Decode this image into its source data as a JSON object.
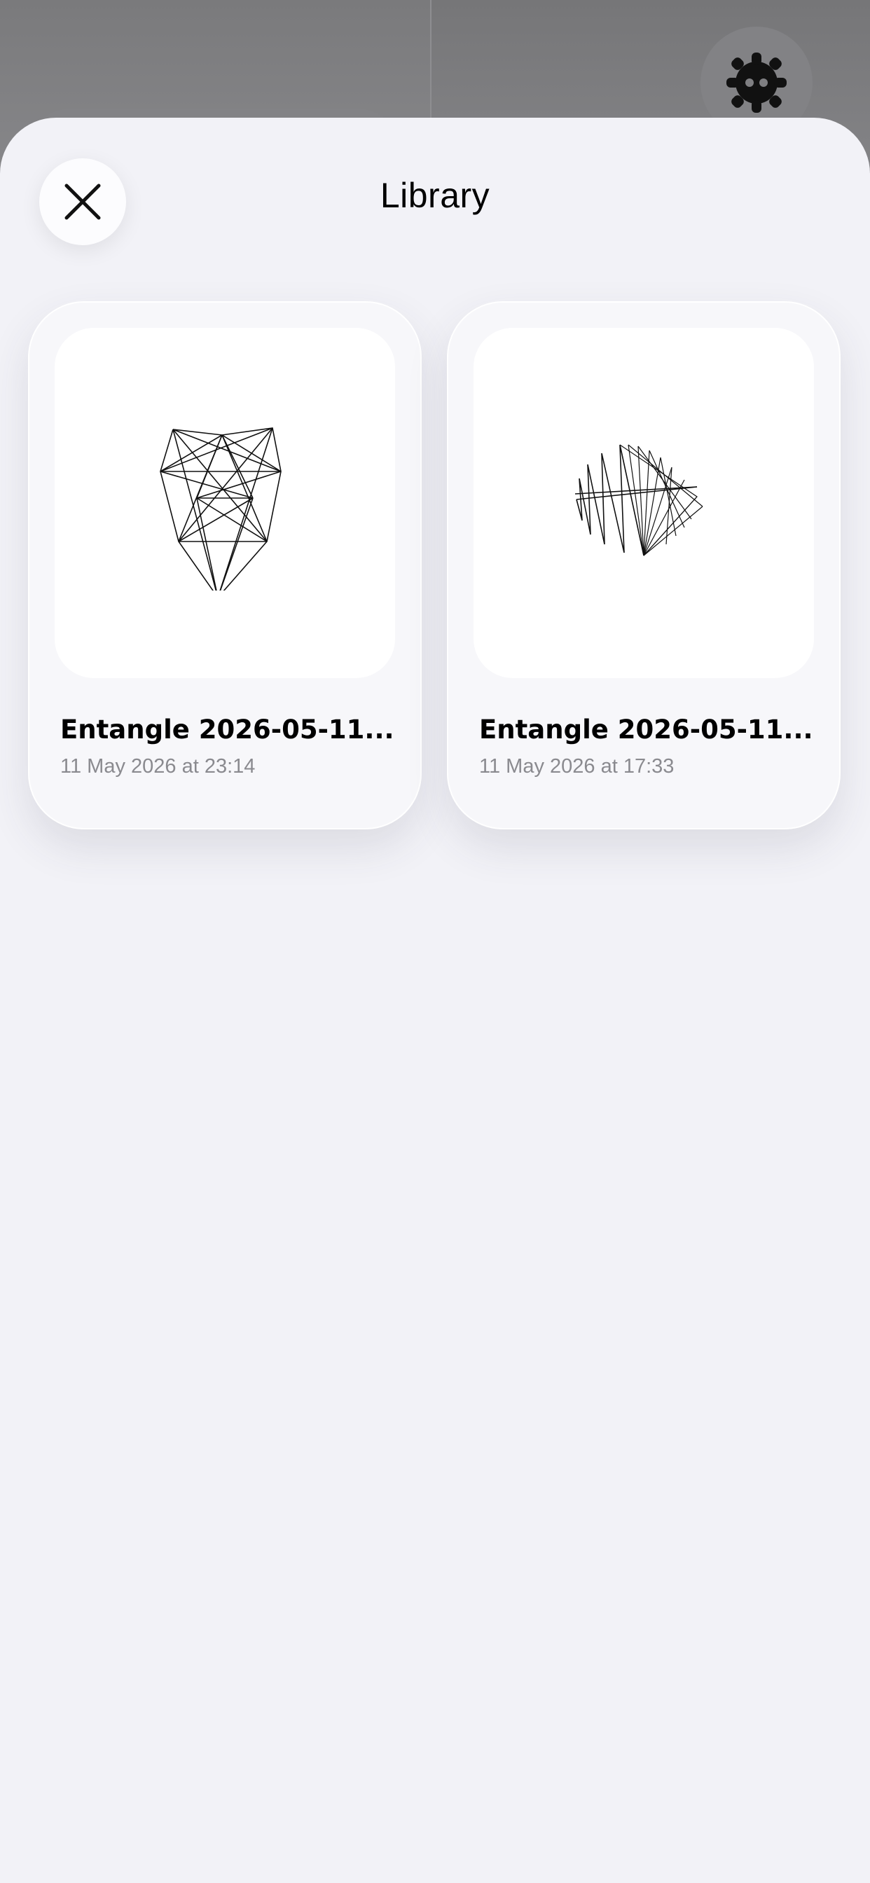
{
  "background": {
    "settings_icon": "gear-face-icon"
  },
  "sheet": {
    "title": "Library",
    "close_icon": "close-icon"
  },
  "items": [
    {
      "title": "Entangle 2026-05-11...",
      "date": "11 May 2026 at 23:14",
      "thumbnail": "geometric-shield-lines"
    },
    {
      "title": "Entangle 2026-05-11...",
      "date": "11 May 2026 at 17:33",
      "thumbnail": "zigzag-sphere-lines"
    }
  ]
}
